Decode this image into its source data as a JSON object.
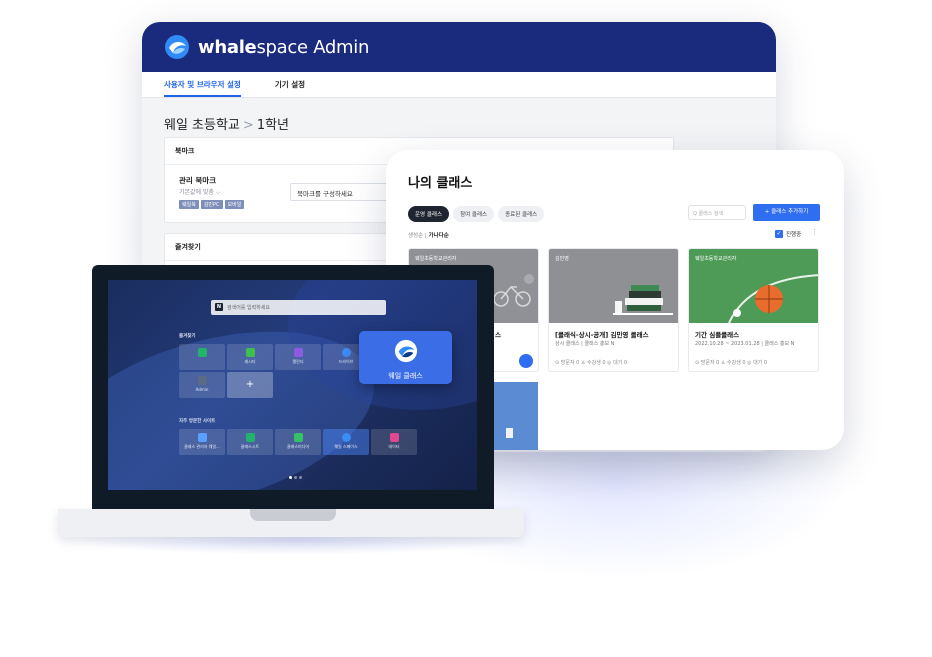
{
  "admin": {
    "brand_bold": "whale",
    "brand_rest": "space Admin",
    "tabs": [
      {
        "label": "사용자 및 브라우저 설정"
      },
      {
        "label": "기기 설정"
      }
    ],
    "breadcrumb": {
      "school": "웨일 초등학교",
      "sep": ">",
      "grade": "1학년"
    },
    "bookmark_panel": {
      "title": "북마크",
      "item_label": "관리 북마크",
      "item_sub": "기본값에 맞춤 ⌵",
      "chips": [
        "웨일북",
        "김민PC",
        "모바일"
      ],
      "select_value": "북마크를 구성하세요"
    },
    "favorites_panel": {
      "title": "즐겨찾기"
    }
  },
  "classes": {
    "title": "나의 클래스",
    "tabs": [
      {
        "label": "운영 클래스",
        "active": true
      },
      {
        "label": "참여 클래스",
        "active": false
      },
      {
        "label": "종료된 클래스",
        "active": false
      }
    ],
    "search_placeholder": "Q 클래스 검색",
    "add_button": "+ 클래스 추가하기",
    "sort": {
      "label": "생성순",
      "active": "가나다순"
    },
    "filter_label": "진행중",
    "cards": [
      {
        "owner": "웨일초등학교관리자",
        "name": "스",
        "meta": "",
        "stats": ""
      },
      {
        "owner": "김민영",
        "name": "[클래식-상시-공개] 김민영 클래스",
        "meta": "상시 클래스  |  클래스 홍보 N",
        "stats": "⊙ 방문자 0   ♙ 수강생 0   ◎ 대기 0"
      },
      {
        "owner": "웨일초등학교관리자",
        "name": "기간 심플클래스",
        "meta": "2022.10.28 ~ 2023.01.28  |  클래스 홍보 N",
        "stats": "⊙ 방문자 0   ♙ 수강생 0   ◎ 대기 0"
      }
    ]
  },
  "laptop": {
    "search_placeholder": "검색어를 입력하세요",
    "search_logo": "N",
    "favorites_title": "즐겨찾기",
    "favorites": [
      {
        "label": "",
        "color": "#23b36b"
      },
      {
        "label": "캐시티",
        "color": "#3fbf4e"
      },
      {
        "label": "캘린더",
        "color": "#8e5be0"
      },
      {
        "label": "드라이브",
        "color": "#3d8bf2"
      },
      {
        "label": "Admin",
        "color": "#5b6b86"
      }
    ],
    "plus": "+",
    "whale_tile_label": "웨일 클래스",
    "frequent_title": "자주 방문한 사이트",
    "frequent": [
      {
        "label": "클래스 관리자 웨일...",
        "color": "#5aa0ff"
      },
      {
        "label": "클래스시트",
        "color": "#23b36b"
      },
      {
        "label": "클래스미디어",
        "color": "#35c06a"
      },
      {
        "label": "웨일 스페이스",
        "color": "#3a8df0"
      },
      {
        "label": "데이터",
        "color": "#e0478e"
      }
    ]
  }
}
